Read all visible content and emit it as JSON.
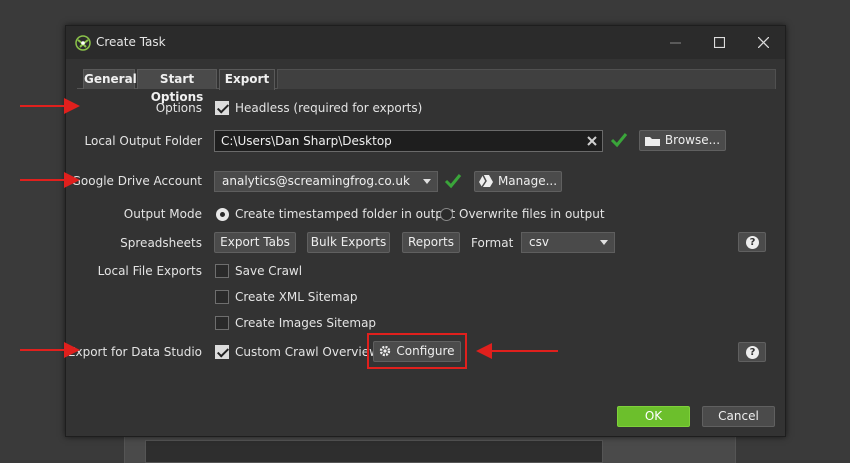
{
  "window": {
    "title": "Create Task"
  },
  "tabs": [
    {
      "label": "General"
    },
    {
      "label": "Start Options"
    },
    {
      "label": "Export"
    }
  ],
  "options": {
    "label": "Options",
    "headless_label": "Headless (required for exports)",
    "headless_checked": true
  },
  "local_output": {
    "label": "Local Output Folder",
    "value": "C:\\Users\\Dan Sharp\\Desktop",
    "browse_label": "Browse..."
  },
  "google_drive": {
    "label": "Google Drive Account",
    "selected": "analytics@screamingfrog.co.uk",
    "manage_label": "Manage..."
  },
  "output_mode": {
    "label": "Output Mode",
    "option_timestamped": "Create timestamped folder in output",
    "option_overwrite": "Overwrite files in output",
    "selected": "timestamped"
  },
  "spreadsheets": {
    "label": "Spreadsheets",
    "export_tabs": "Export Tabs",
    "bulk_exports": "Bulk Exports",
    "reports": "Reports",
    "format_label": "Format",
    "format_value": "csv"
  },
  "local_file_exports": {
    "label": "Local File Exports",
    "items": [
      {
        "label": "Save Crawl",
        "checked": false
      },
      {
        "label": "Create XML Sitemap",
        "checked": false
      },
      {
        "label": "Create Images Sitemap",
        "checked": false
      }
    ]
  },
  "data_studio": {
    "label": "Export for Data Studio",
    "custom_overview_label": "Custom Crawl Overview",
    "custom_overview_checked": true,
    "configure_label": "Configure"
  },
  "footer": {
    "ok_label": "OK",
    "cancel_label": "Cancel"
  },
  "colors": {
    "accent_ok": "#6cbf2c",
    "tick_green": "#3aa53a",
    "annotation_red": "#e0201d"
  }
}
